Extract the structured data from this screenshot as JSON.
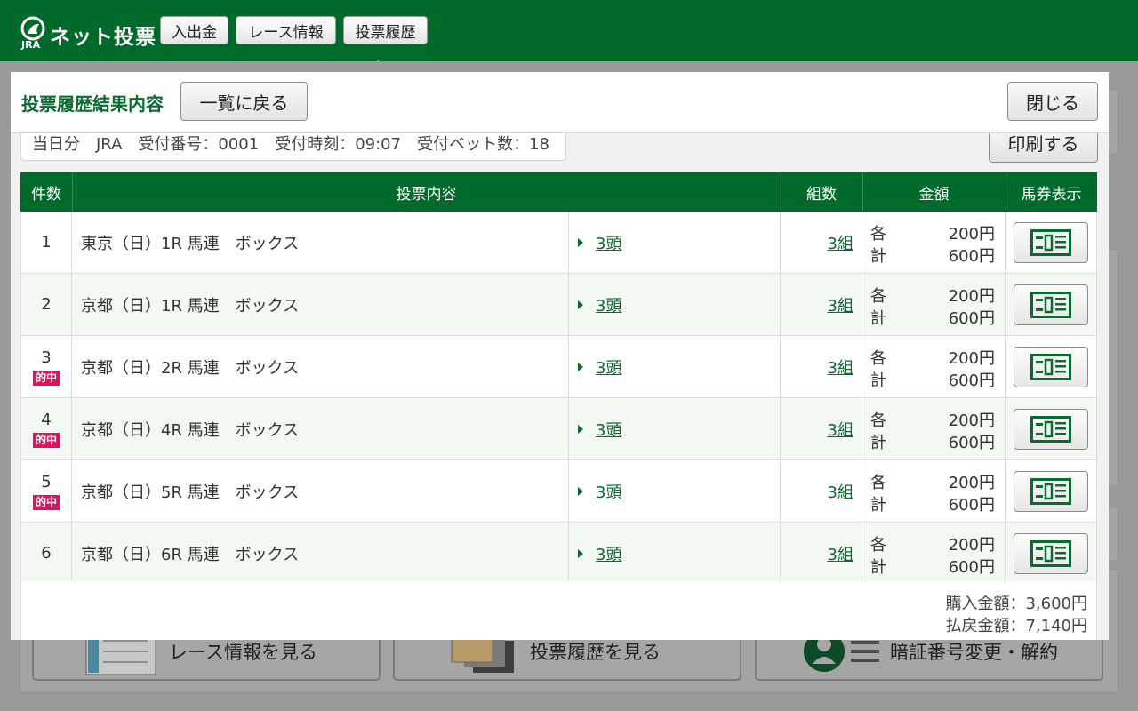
{
  "app": {
    "logo_text": "ネット投票",
    "logo_sub": "JRA"
  },
  "nav": {
    "items": [
      {
        "label": "入出金"
      },
      {
        "label": "レース情報"
      },
      {
        "label": "投票履歴"
      }
    ],
    "active": "投票履歴"
  },
  "modal": {
    "title": "投票履歴結果内容",
    "back_label": "一覧に戻る",
    "close_label": "閉じる",
    "print_label": "印刷する",
    "info": "当日分　JRA　受付番号：0001　受付時刻：09:07　受付ベット数：18"
  },
  "table": {
    "headers": {
      "count": "件数",
      "content": "投票内容",
      "combos": "組数",
      "amount": "金額",
      "ticket": "馬券表示"
    },
    "hit_label": "的中",
    "each_label": "各",
    "total_label": "計",
    "rows": [
      {
        "no": "1",
        "hit": false,
        "desc": "東京（日）1R  馬連　ボックス",
        "heads": "3頭",
        "combos": "3組",
        "each": "200円",
        "total": "600円"
      },
      {
        "no": "2",
        "hit": false,
        "desc": "京都（日）1R  馬連　ボックス",
        "heads": "3頭",
        "combos": "3組",
        "each": "200円",
        "total": "600円"
      },
      {
        "no": "3",
        "hit": true,
        "desc": "京都（日）2R  馬連　ボックス",
        "heads": "3頭",
        "combos": "3組",
        "each": "200円",
        "total": "600円"
      },
      {
        "no": "4",
        "hit": true,
        "desc": "京都（日）4R  馬連　ボックス",
        "heads": "3頭",
        "combos": "3組",
        "each": "200円",
        "total": "600円"
      },
      {
        "no": "5",
        "hit": true,
        "desc": "京都（日）5R  馬連　ボックス",
        "heads": "3頭",
        "combos": "3組",
        "each": "200円",
        "total": "600円"
      },
      {
        "no": "6",
        "hit": false,
        "desc": "京都（日）6R  馬連　ボックス",
        "heads": "3頭",
        "combos": "3組",
        "each": "200円",
        "total": "600円"
      }
    ],
    "purchase_total": "購入金額：3,600円",
    "payout_total": "払戻金額：7,140円"
  },
  "background": {
    "buttons": [
      {
        "label": "レース情報を見る",
        "icon": "race-card-icon"
      },
      {
        "label": "投票履歴を見る",
        "icon": "tickets-icon"
      },
      {
        "label": "暗証番号変更・解約",
        "icon": "user-list-icon"
      }
    ]
  },
  "colors": {
    "brand_green": "#006a2a",
    "hit_pink": "#e0115f",
    "link_green": "#0a6b30"
  }
}
